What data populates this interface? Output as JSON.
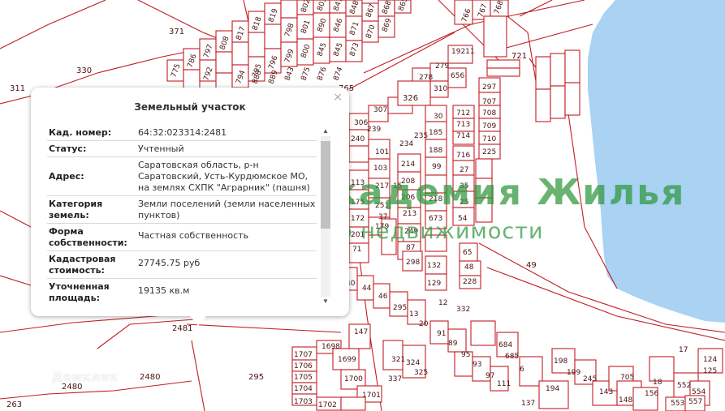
{
  "map": {
    "water_color": "#a9d2f3",
    "line_color": "#c21d24",
    "text_color": "#4a1010",
    "label_371": "371",
    "label_330": "330",
    "label_311": "311",
    "label_765": "765",
    "label_721": "721",
    "label_49": "49",
    "label_2481": "2481",
    "label_2480": "2480",
    "label_2480b": "2480",
    "label_295": "295",
    "label_263": "263",
    "label_326": "326",
    "label_297": "297",
    "label_332": "332",
    "label_147": "147",
    "label_198": "198",
    "label_194": "194",
    "label_705": "705",
    "label_6": "6",
    "label_13": "13",
    "label_12": "12",
    "label_17": "17",
    "label_124": "124",
    "label_225": "225"
  },
  "watermark": {
    "line1": "Академия Жилья",
    "line2": "Агентство недвижимости"
  },
  "brand": {
    "text": "Домклик"
  },
  "popup": {
    "title": "Земельный участок",
    "close": "×",
    "rows": [
      {
        "key": "Кад. номер:",
        "value": "64:32:023314:2481"
      },
      {
        "key": "Статус:",
        "value": "Учтенный"
      },
      {
        "key": "Адрес:",
        "value": "Саратовская область, р-н Саратовский, Усть-Курдюмское МО, на землях СХПК \"Аграрник\" (пашня)"
      },
      {
        "key": "Категория земель:",
        "value": "Земли поселений (земли населенных пунктов)"
      },
      {
        "key": "Форма собственности:",
        "value": "Частная собственность"
      },
      {
        "key": "Кадастровая стоимость:",
        "value": "27745.75 руб"
      },
      {
        "key": "Уточненная площадь:",
        "value": "19135 кв.м"
      }
    ]
  }
}
